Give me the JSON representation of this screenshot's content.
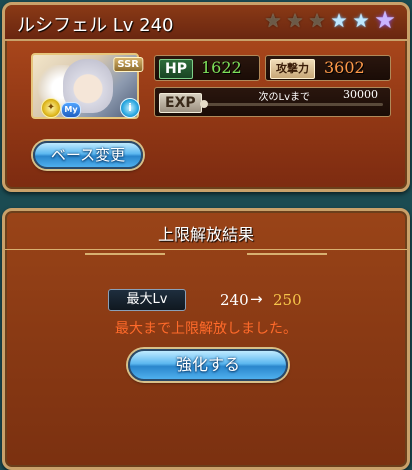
{
  "character": {
    "name_level": "ルシフェル Lv 240",
    "rarity_badge": "SSR",
    "element_icon": "light-element-icon",
    "my_badge": "My",
    "info_icon": "info-icon"
  },
  "stars": {
    "bronze": 3,
    "blue": 2,
    "purple": 1
  },
  "stats": {
    "hp_label": "HP",
    "hp_value": "1622",
    "atk_label": "攻撃力",
    "atk_value": "3602",
    "exp_label": "EXP",
    "next_level_label": "次のLvまで",
    "next_level_value": "30000"
  },
  "buttons": {
    "base_change": "ベース変更",
    "enhance": "強化する"
  },
  "result": {
    "title": "上限解放結果",
    "max_level_label": "最大Lv",
    "level_from": "240",
    "arrow": "→",
    "level_to": "250",
    "message": "最大まで上限解放しました。"
  },
  "colors": {
    "accent_gold": "#f5c44a",
    "message_red": "#ff6a2a",
    "hp_green": "#7ee05a",
    "atk_orange": "#ff9a4a"
  }
}
